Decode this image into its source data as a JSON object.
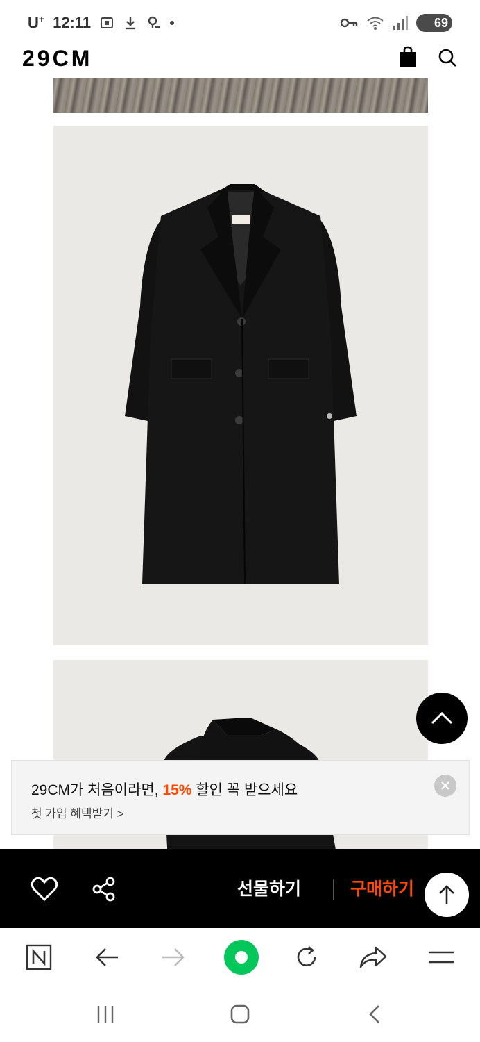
{
  "status_bar": {
    "carrier": "U",
    "carrier_sup": "+",
    "time": "12:11",
    "battery": "69"
  },
  "header": {
    "logo": "29CM"
  },
  "promo": {
    "title_pre": "29CM가 처음이라면, ",
    "discount": "15%",
    "title_post": " 할인 꼭 받으세요",
    "subtitle": "첫 가입 혜택받기 >"
  },
  "action_bar": {
    "gift_label": "선물하기",
    "buy_label": "구매하기"
  },
  "colors": {
    "accent": "#ff4800",
    "action_bar_bg": "#000000",
    "image_bg": "#ebe9e6",
    "naver_green": "#03c75a"
  },
  "icons": {
    "header": [
      "shopping-bag-icon",
      "search-icon"
    ],
    "action_bar": [
      "heart-icon",
      "share-icon",
      "arrow-up-icon"
    ],
    "browser": [
      "naver-n-icon",
      "back-arrow-icon",
      "forward-arrow-icon",
      "naver-home-icon",
      "refresh-icon",
      "share-arrow-icon",
      "menu-icon"
    ],
    "nav": [
      "recent-apps-icon",
      "home-icon",
      "back-icon"
    ]
  }
}
